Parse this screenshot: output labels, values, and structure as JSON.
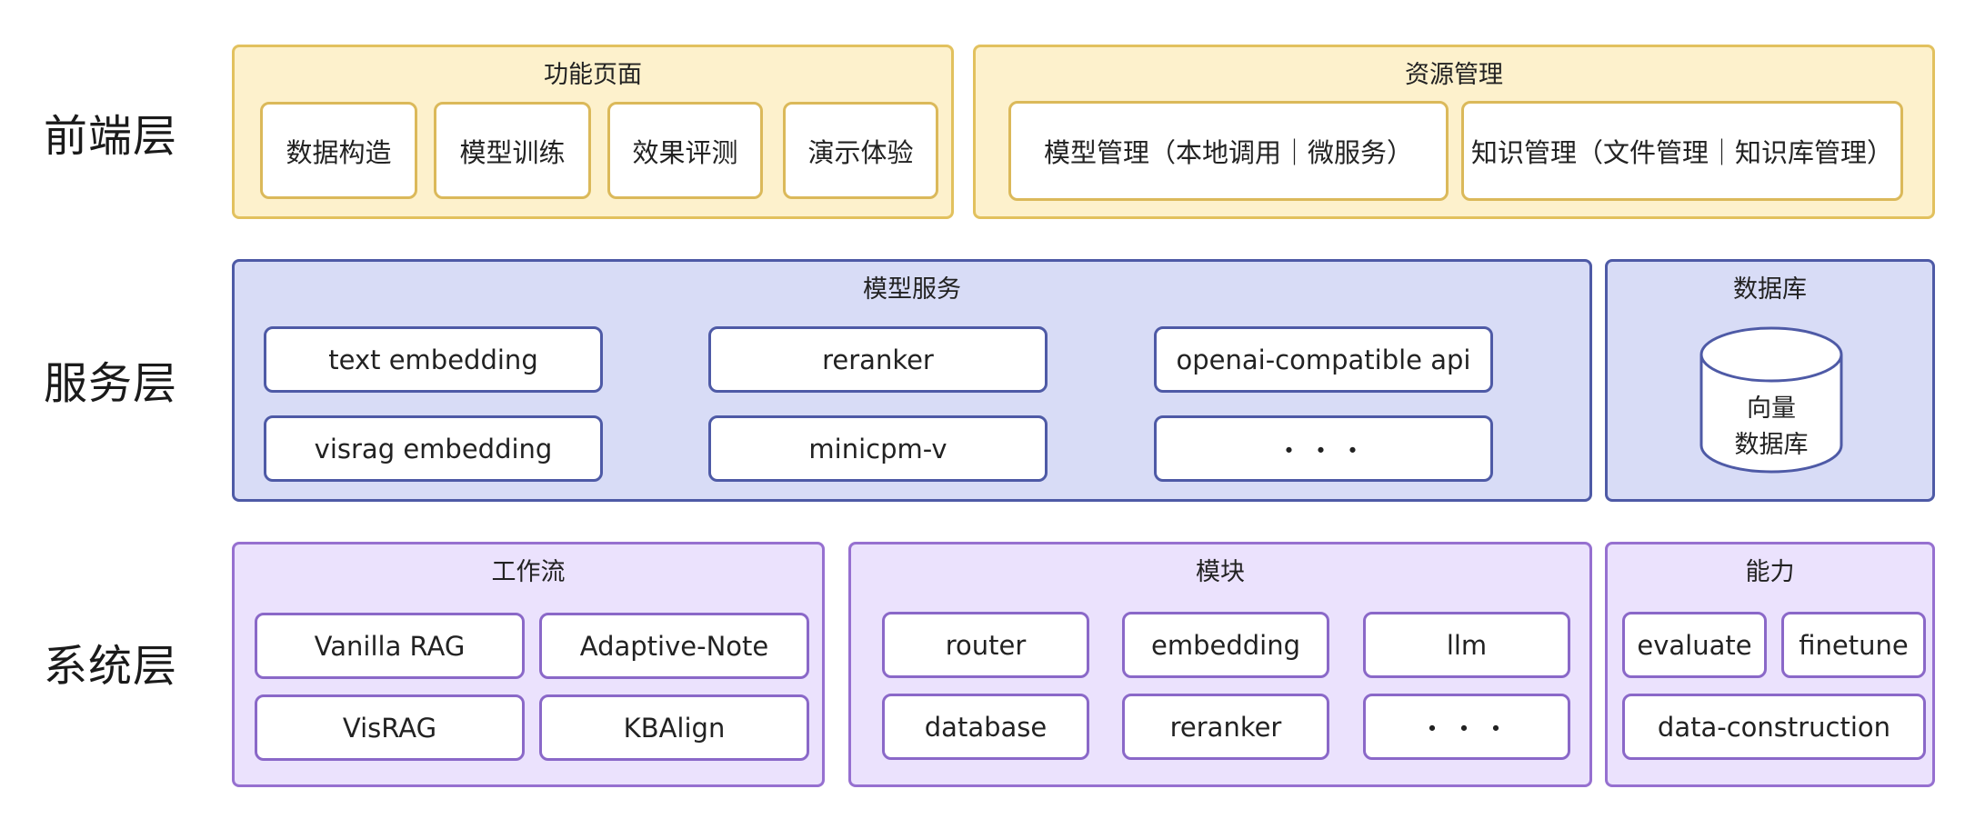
{
  "layers": {
    "frontend": "前端层",
    "service": "服务层",
    "system": "系统层"
  },
  "frontend": {
    "function_pages": {
      "title": "功能页面",
      "items": [
        "数据构造",
        "模型训练",
        "效果评测",
        "演示体验"
      ]
    },
    "resource_mgmt": {
      "title": "资源管理",
      "items": [
        "模型管理（本地调用｜微服务）",
        "知识管理（文件管理｜知识库管理）"
      ]
    }
  },
  "service": {
    "model_service": {
      "title": "模型服务",
      "items": [
        "text embedding",
        "reranker",
        "openai-compatible api",
        "visrag embedding",
        "minicpm-v",
        "・・・"
      ]
    },
    "database": {
      "title": "数据库",
      "cylinder_line1": "向量",
      "cylinder_line2": "数据库"
    }
  },
  "system": {
    "workflow": {
      "title": "工作流",
      "items": [
        "Vanilla RAG",
        "Adaptive-Note",
        "VisRAG",
        "KBAlign"
      ]
    },
    "modules": {
      "title": "模块",
      "items": [
        "router",
        "embedding",
        "llm",
        "database",
        "reranker",
        "・・・"
      ]
    },
    "capability": {
      "title": "能力",
      "items": [
        "evaluate",
        "finetune",
        "data-construction"
      ]
    }
  },
  "colors": {
    "frontend_fill": "#fdf1cc",
    "frontend_border": "#e2c15e",
    "service_fill": "#d8dcf6",
    "service_border": "#4e5aa6",
    "system_fill": "#ebe2fd",
    "system_border": "#9670d0"
  }
}
